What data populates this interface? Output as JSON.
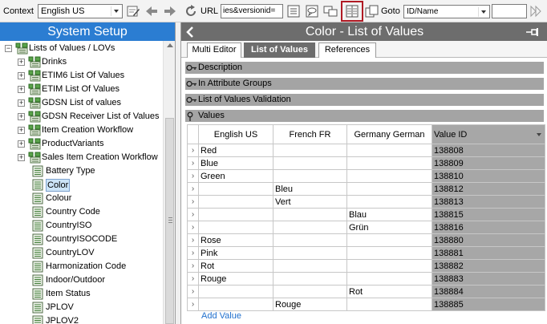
{
  "toolbar": {
    "context_label": "Context",
    "context_value": "English US",
    "url_label": "URL",
    "url_value": "ies&versionid=",
    "goto_label": "Goto",
    "goto_value": "ID/Name"
  },
  "left_panel": {
    "title": "System Setup",
    "tree": [
      {
        "label": "Lists of Values / LOVs",
        "type": "folder",
        "expander": "−",
        "level": 0
      },
      {
        "label": "Drinks",
        "type": "folder",
        "expander": "+",
        "level": 1
      },
      {
        "label": "ETIM6 List Of Values",
        "type": "folder",
        "expander": "+",
        "level": 1
      },
      {
        "label": "ETIM List Of Values",
        "type": "folder",
        "expander": "+",
        "level": 1
      },
      {
        "label": "GDSN List of values",
        "type": "folder",
        "expander": "+",
        "level": 1
      },
      {
        "label": "GDSN Receiver List of Values",
        "type": "folder",
        "expander": "+",
        "level": 1
      },
      {
        "label": "Item Creation Workflow",
        "type": "folder",
        "expander": "+",
        "level": 1
      },
      {
        "label": "ProductVariants",
        "type": "folder",
        "expander": "+",
        "level": 1
      },
      {
        "label": "Sales Item Creation Workflow",
        "type": "folder",
        "expander": "+",
        "level": 1
      },
      {
        "label": "Battery Type",
        "type": "leaf",
        "level": 1
      },
      {
        "label": "Color",
        "type": "leaf",
        "level": 1,
        "selected": true
      },
      {
        "label": "Colour",
        "type": "leaf",
        "level": 1
      },
      {
        "label": "Country Code",
        "type": "leaf",
        "level": 1
      },
      {
        "label": "CountryISO",
        "type": "leaf",
        "level": 1
      },
      {
        "label": "CountryISOCODE",
        "type": "leaf",
        "level": 1
      },
      {
        "label": "CountryLOV",
        "type": "leaf",
        "level": 1
      },
      {
        "label": "Harmonization Code",
        "type": "leaf",
        "level": 1
      },
      {
        "label": "Indoor/Outdoor",
        "type": "leaf",
        "level": 1
      },
      {
        "label": "Item Status",
        "type": "leaf",
        "level": 1
      },
      {
        "label": "JPLOV",
        "type": "leaf",
        "level": 1
      },
      {
        "label": "JPLOV2",
        "type": "leaf",
        "level": 1
      }
    ]
  },
  "right_panel": {
    "title": "Color - List of Values",
    "tabs": [
      {
        "label": "Multi Editor",
        "active": false
      },
      {
        "label": "List of Values",
        "active": true
      },
      {
        "label": "References",
        "active": false
      }
    ],
    "sections": [
      {
        "label": "Description",
        "icon": "key-icon"
      },
      {
        "label": "In Attribute Groups",
        "icon": "key-icon"
      },
      {
        "label": "List of Values Validation",
        "icon": "key-icon"
      },
      {
        "label": "Values",
        "icon": "pin-icon"
      }
    ],
    "columns": [
      "English US",
      "French FR",
      "Germany German",
      "Value ID"
    ],
    "rows": [
      {
        "en": "Red",
        "fr": "",
        "de": "",
        "id": "138808"
      },
      {
        "en": "Blue",
        "fr": "",
        "de": "",
        "id": "138809"
      },
      {
        "en": "Green",
        "fr": "",
        "de": "",
        "id": "138810"
      },
      {
        "en": "",
        "fr": "Bleu",
        "de": "",
        "id": "138812"
      },
      {
        "en": "",
        "fr": "Vert",
        "de": "",
        "id": "138813"
      },
      {
        "en": "",
        "fr": "",
        "de": "Blau",
        "id": "138815"
      },
      {
        "en": "",
        "fr": "",
        "de": "Grün",
        "id": "138816"
      },
      {
        "en": "Rose",
        "fr": "",
        "de": "",
        "id": "138880"
      },
      {
        "en": "Pink",
        "fr": "",
        "de": "",
        "id": "138881"
      },
      {
        "en": "Rot",
        "fr": "",
        "de": "",
        "id": "138882"
      },
      {
        "en": "Rouge",
        "fr": "",
        "de": "",
        "id": "138883"
      },
      {
        "en": "",
        "fr": "",
        "de": "Rot",
        "id": "138884"
      },
      {
        "en": "",
        "fr": "Rouge",
        "de": "",
        "id": "138885"
      }
    ],
    "row_marker": "›",
    "add_value_label": "Add Value"
  },
  "colors": {
    "left_header_bg": "#2b7dd2",
    "right_header_bg": "#6d6d6d",
    "selected_tool_border": "#b01a24",
    "value_id_column_bg": "#a7a7a7",
    "link": "#1f6fcd"
  }
}
